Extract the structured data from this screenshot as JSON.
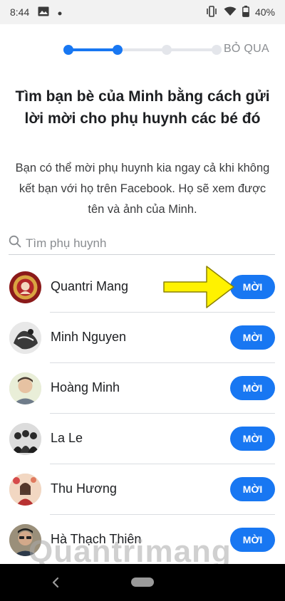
{
  "status_bar": {
    "time": "8:44",
    "battery": "40%",
    "icons": [
      "image-icon",
      "notification-dot-icon",
      "vibrate-icon",
      "wifi-icon",
      "battery-icon"
    ]
  },
  "onboarding": {
    "steps_total": 4,
    "current_step": 2,
    "skip_label": "BỎ QUA",
    "title": "Tìm bạn bè của Minh bằng cách gửi lời mời cho phụ huynh các bé đó",
    "subtitle": "Bạn có thể mời phụ huynh kia ngay cả khi không kết bạn với họ trên Facebook. Họ sẽ xem được tên và ảnh của Minh.",
    "accent_color": "#1877f2"
  },
  "search": {
    "placeholder": "Tìm phụ huynh",
    "value": ""
  },
  "contacts": [
    {
      "name": "Quantri Mang",
      "invite_label": "MỜI"
    },
    {
      "name": "Minh Nguyen",
      "invite_label": "MỜI"
    },
    {
      "name": "Hoàng Minh",
      "invite_label": "MỜI"
    },
    {
      "name": "La Le",
      "invite_label": "MỜI"
    },
    {
      "name": "Thu Hương",
      "invite_label": "MỜI"
    },
    {
      "name": "Hà Thạch Thiên",
      "invite_label": "MỜI"
    }
  ],
  "watermark": "Quantrimang"
}
